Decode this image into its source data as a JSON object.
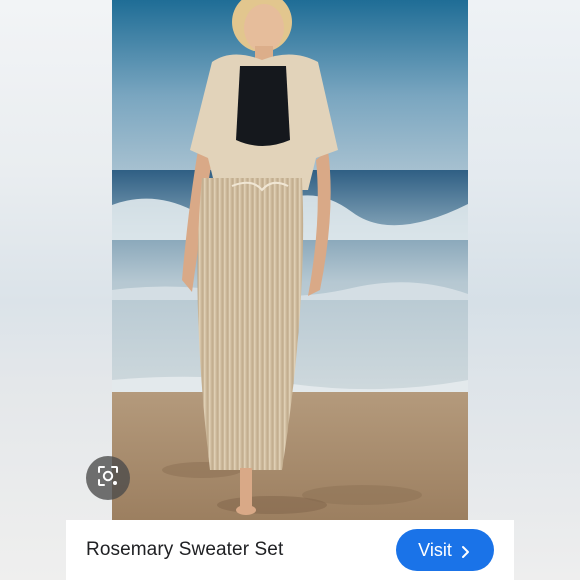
{
  "product": {
    "title": "Rosemary Sweater Set"
  },
  "actions": {
    "visit_label": "Visit"
  },
  "icons": {
    "lens": "visual-search-icon",
    "visit_arrow": "chevron-right-icon"
  },
  "colors": {
    "visit_button": "#1a73e8",
    "card_background": "#ffffff",
    "title_text": "#202124"
  }
}
